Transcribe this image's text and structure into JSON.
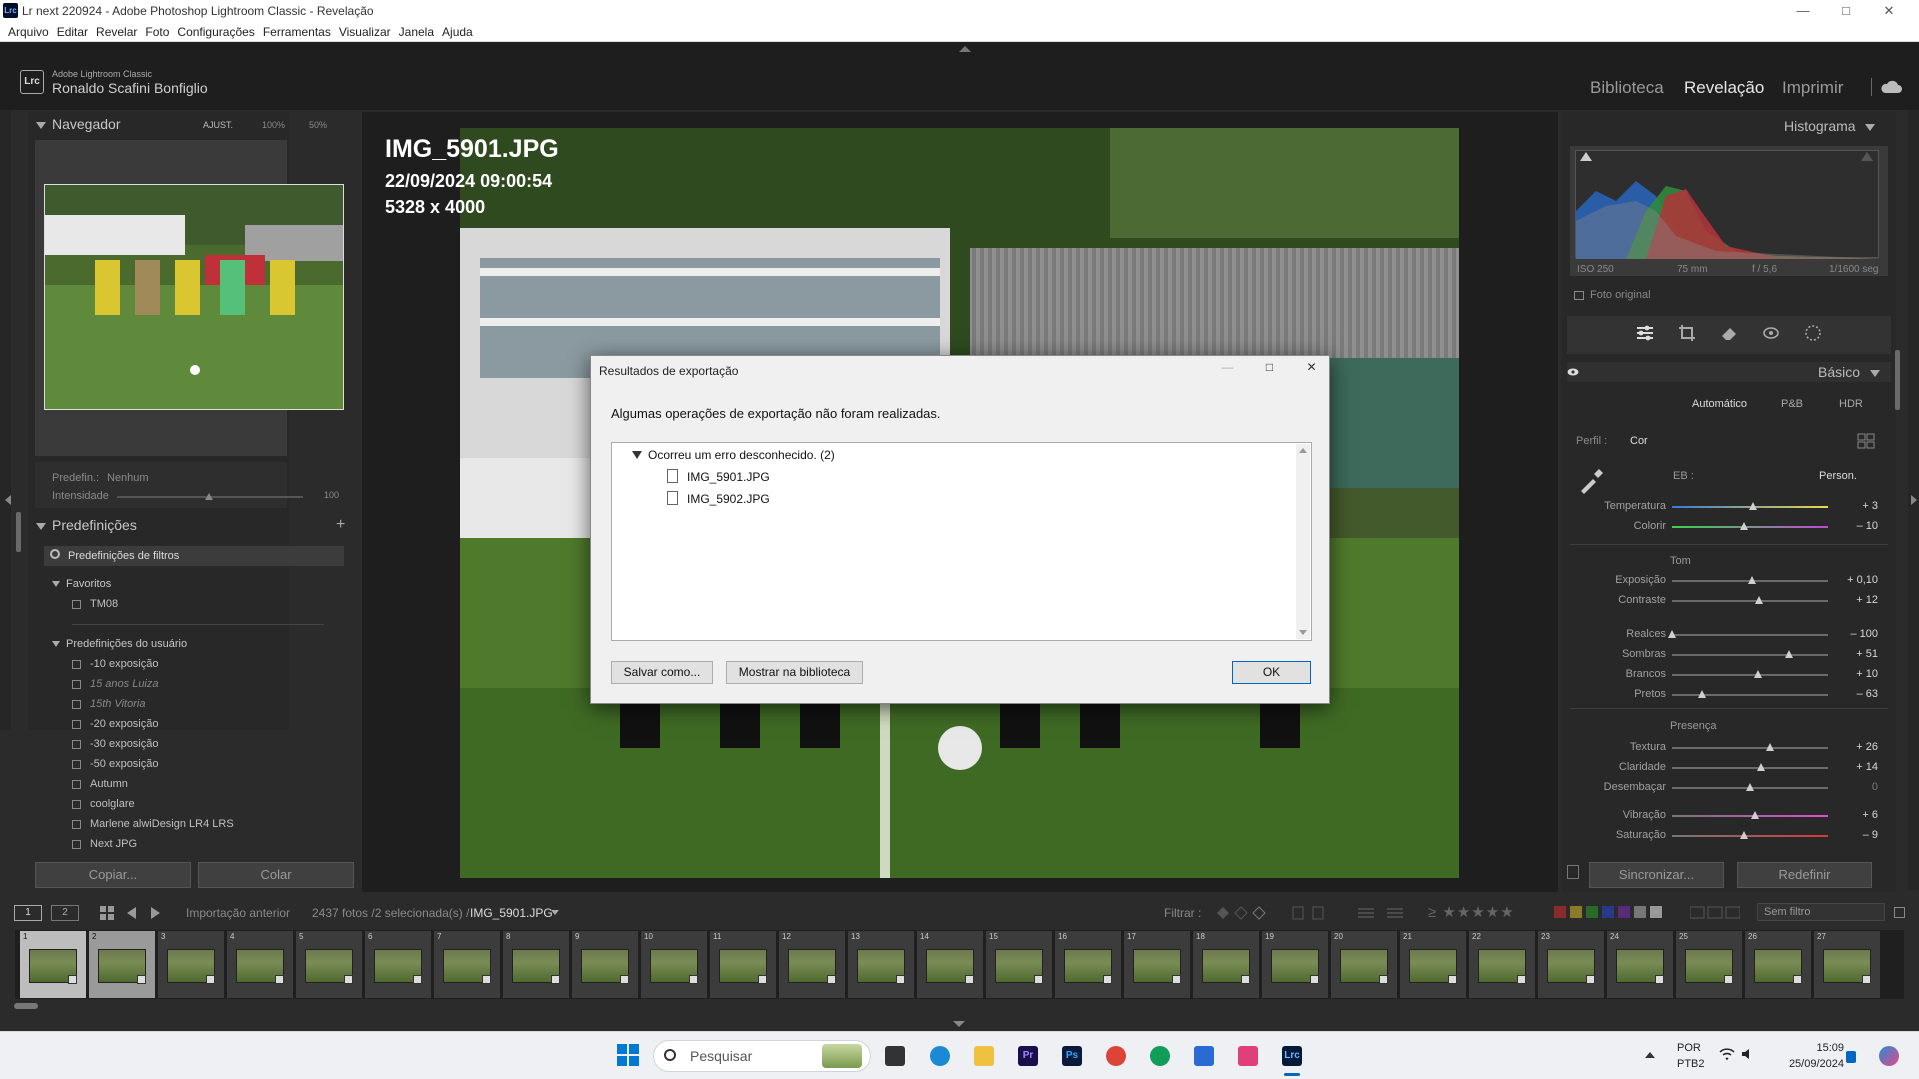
{
  "window": {
    "title": "Lr next 220924 - Adobe Photoshop Lightroom Classic - Revelação",
    "logo_text": "Lrc"
  },
  "menu": [
    "Arquivo",
    "Editar",
    "Revelar",
    "Foto",
    "Configurações",
    "Ferramentas",
    "Visualizar",
    "Janela",
    "Ajuda"
  ],
  "identity": {
    "app": "Adobe Lightroom Classic",
    "user": "Ronaldo Scafini Bonfiglio",
    "logo": "Lrc"
  },
  "modules": {
    "library": "Biblioteca",
    "develop": "Revelação",
    "print": "Imprimir",
    "cloud_icon": "cloud-icon"
  },
  "navigator": {
    "title": "Navegador",
    "zoom_options": [
      "AJUST.",
      "100%",
      "50%"
    ]
  },
  "preset_amount": {
    "preset_label": "Predefin.:",
    "preset_value": "Nenhum",
    "intensity_label": "Intensidade",
    "intensity_value": "100"
  },
  "presets": {
    "title": "Predefinições",
    "filter_placeholder": "Predefinições de filtros",
    "favorites_title": "Favoritos",
    "favorites": [
      "TM08"
    ],
    "user_title": "Predefinições do usuário",
    "user": [
      "-10 exposição",
      "15 anos Luiza",
      "15th Vitoria",
      "-20 exposição",
      "-30 exposição",
      "-50 exposição",
      "Autumn",
      "coolglare",
      "Marlene alwiDesign LR4 LRS",
      "Next JPG"
    ]
  },
  "left_buttons": {
    "copy": "Copiar...",
    "paste": "Colar"
  },
  "photo_info": {
    "filename": "IMG_5901.JPG",
    "datetime": "22/09/2024 09:00:54",
    "dimensions": "5328 x 4000"
  },
  "histogram": {
    "title": "Histograma",
    "iso": "ISO 250",
    "focal": "75 mm",
    "aperture": "f / 5,6",
    "shutter": "1/1600 seg",
    "original_label": "Foto original"
  },
  "basic": {
    "title": "Básico",
    "auto": "Automático",
    "bw": "P&B",
    "hdr": "HDR",
    "profile_label": "Perfil :",
    "profile_value": "Cor",
    "wb_label": "EB :",
    "wb_value": "Person.",
    "tone_title": "Tom",
    "presence_title": "Presença",
    "sliders": [
      {
        "label": "Temperatura",
        "value": "+ 3",
        "pos": 0.52,
        "group": "wb"
      },
      {
        "label": "Colorir",
        "value": "– 10",
        "pos": 0.46,
        "group": "wb"
      },
      {
        "label": "Exposição",
        "value": "+ 0,10",
        "pos": 0.51,
        "group": "tone"
      },
      {
        "label": "Contraste",
        "value": "+ 12",
        "pos": 0.56,
        "group": "tone"
      },
      {
        "label": "Realces",
        "value": "– 100",
        "pos": 0.0,
        "group": "tone2"
      },
      {
        "label": "Sombras",
        "value": "+ 51",
        "pos": 0.75,
        "group": "tone2"
      },
      {
        "label": "Brancos",
        "value": "+ 10",
        "pos": 0.55,
        "group": "tone2"
      },
      {
        "label": "Pretos",
        "value": "– 63",
        "pos": 0.19,
        "group": "tone2"
      },
      {
        "label": "Textura",
        "value": "+ 26",
        "pos": 0.63,
        "group": "presence"
      },
      {
        "label": "Claridade",
        "value": "+ 14",
        "pos": 0.57,
        "group": "presence"
      },
      {
        "label": "Desembaçar",
        "value": "0",
        "pos": 0.5,
        "group": "presence"
      },
      {
        "label": "Vibração",
        "value": "+ 6",
        "pos": 0.53,
        "group": "presence2"
      },
      {
        "label": "Saturação",
        "value": "– 9",
        "pos": 0.46,
        "group": "presence2"
      }
    ]
  },
  "right_buttons": {
    "sync": "Sincronizar...",
    "reset": "Redefinir"
  },
  "dialog": {
    "title": "Resultados de exportação",
    "message": "Algumas operações de exportação não foram realizadas.",
    "error_group": "Ocorreu um erro desconhecido. (2)",
    "files": [
      "IMG_5901.JPG",
      "IMG_5902.JPG"
    ],
    "save_as": "Salvar como...",
    "show_in_library": "Mostrar na biblioteca",
    "ok": "OK"
  },
  "filmstrip_bar": {
    "screen1": "1",
    "screen2": "2",
    "source": "Importação anterior",
    "count": "2437 fotos /2 selecionada(s) /",
    "current": "IMG_5901.JPG",
    "filter_label": "Filtrar :",
    "filter_value": "Sem filtro"
  },
  "filmstrip": {
    "numbers": [
      "1",
      "2",
      "3",
      "4",
      "5",
      "6",
      "7",
      "8",
      "9",
      "10",
      "11",
      "12",
      "13",
      "14",
      "15",
      "16",
      "17",
      "18",
      "19",
      "20",
      "21",
      "22",
      "23",
      "24",
      "25",
      "26",
      "27"
    ]
  },
  "taskbar": {
    "search": "Pesquisar",
    "lang1": "POR",
    "lang2": "PTB2",
    "time": "15:09",
    "date": "25/09/2024"
  }
}
